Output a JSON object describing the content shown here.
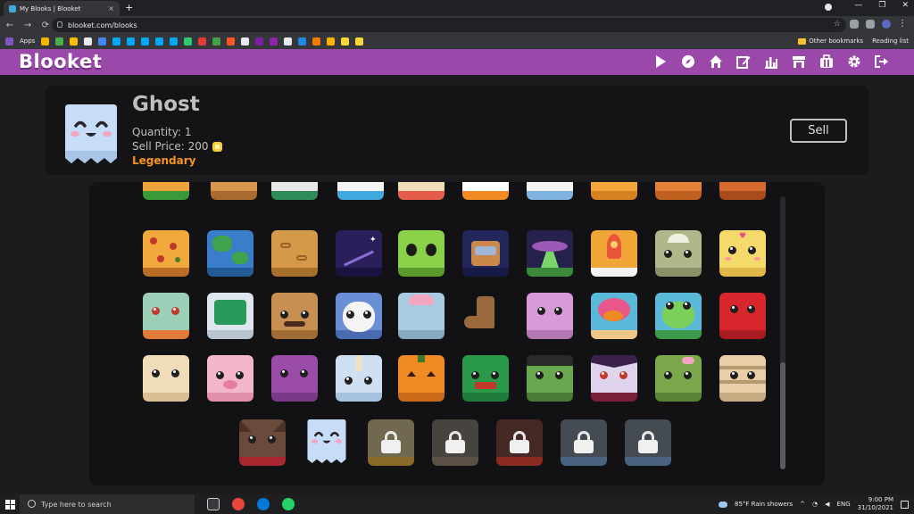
{
  "browser": {
    "tab_title": "My Blooks | Blooket",
    "tab_close": "×",
    "new_tab": "+",
    "url": "blooket.com/blooks",
    "bookmarks_apps": "Apps",
    "bookmarks_other": "Other bookmarks",
    "bookmarks_reading": "Reading list",
    "back": "←",
    "forward": "→",
    "reload": "⟳",
    "star": "☆",
    "menu": "⋮",
    "min": "—",
    "max": "❐",
    "close": "✕"
  },
  "app": {
    "logo": "Blooket",
    "nav": [
      "play-icon",
      "discover-icon",
      "home-icon",
      "create-icon",
      "stats-icon",
      "market-icon",
      "blooks-icon",
      "settings-icon",
      "logout-icon"
    ]
  },
  "selected": {
    "name": "Ghost",
    "quantity": "Quantity: 1",
    "sell_price": "Sell Price: 200",
    "rarity": "Legendary",
    "rarity_color": "#f7931e",
    "sell_label": "Sell"
  },
  "taskbar": {
    "search_placeholder": "Type here to search",
    "weather": "85°F  Rain showers",
    "lang": "ENG",
    "time": "9:00 PM",
    "date": "31/10/2021"
  }
}
